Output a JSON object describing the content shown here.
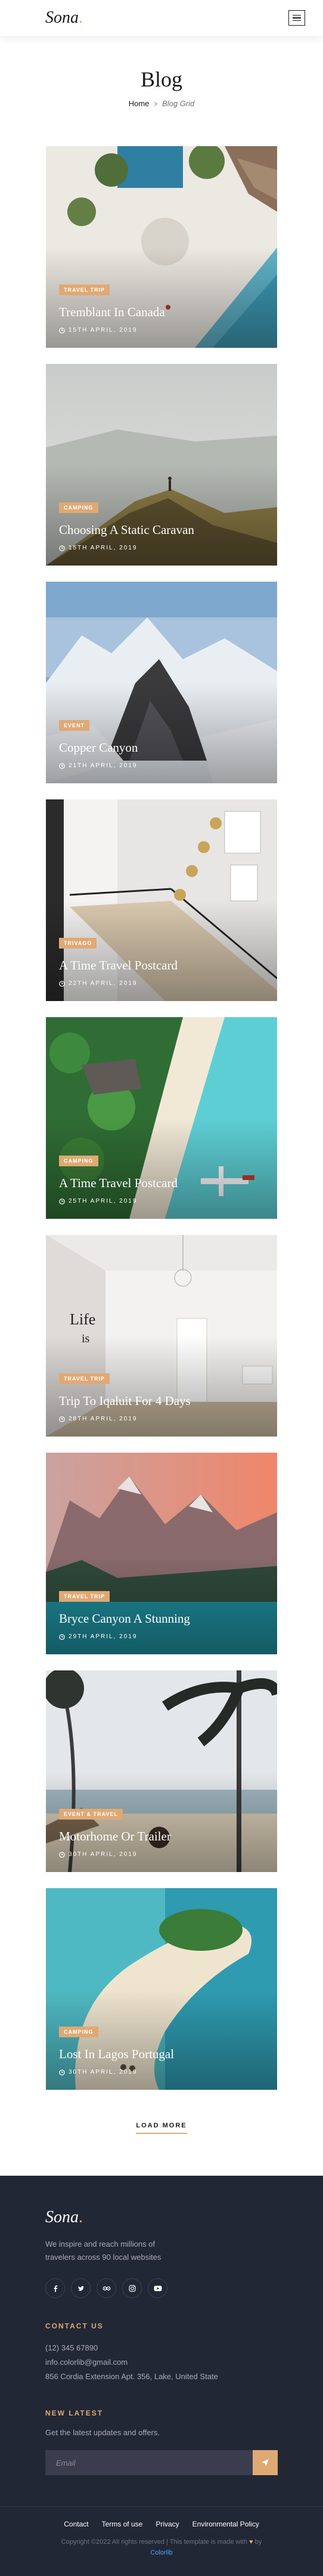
{
  "header": {
    "logo": "Sona",
    "logo_dot": "."
  },
  "breadcrumb": {
    "title": "Blog",
    "home": "Home",
    "separator": ">",
    "current": "Blog Grid"
  },
  "posts": [
    {
      "tag": "Travel Trip",
      "title": "Tremblant In Canada",
      "date": "15th April, 2019"
    },
    {
      "tag": "Camping",
      "title": "Choosing A Static Caravan",
      "date": "15th April, 2019"
    },
    {
      "tag": "Event",
      "title": "Copper Canyon",
      "date": "21th April, 2019"
    },
    {
      "tag": "Trivago",
      "title": "A Time Travel Postcard",
      "date": "22th April, 2019"
    },
    {
      "tag": "Camping",
      "title": "A Time Travel Postcard",
      "date": "25th April, 2019"
    },
    {
      "tag": "Travel Trip",
      "title": "Trip To Iqaluit For 4 Days",
      "date": "28th April, 2019"
    },
    {
      "tag": "Travel Trip",
      "title": "Bryce Canyon A Stunning",
      "date": "29th April, 2019"
    },
    {
      "tag": "Event & Travel",
      "title": "Motorhome Or Trailer",
      "date": "30th April, 2019"
    },
    {
      "tag": "Camping",
      "title": "Lost In Lagos Portugal",
      "date": "30th April, 2019"
    }
  ],
  "load_more": "Load More",
  "footer": {
    "logo": "Sona",
    "logo_dot": ".",
    "about": "We inspire and reach millions of travelers across 90 local websites",
    "socials": [
      "facebook-icon",
      "twitter-icon",
      "tripadvisor-icon",
      "instagram-icon",
      "youtube-icon"
    ],
    "contact_heading": "Contact Us",
    "phone": "(12) 345 67890",
    "email": "info.colorlib@gmail.com",
    "address": "856 Cordia Extension Apt. 356, Lake, United State",
    "newsletter_heading": "New Latest",
    "newsletter_text": "Get the latest updates and offers.",
    "email_placeholder": "Email",
    "links": [
      "Contact",
      "Terms of use",
      "Privacy",
      "Environmental Policy"
    ],
    "copyright": "Copyright ©2022 All rights reserved | This template is made with",
    "copyright_by": "by",
    "brand": "Colorlib"
  },
  "colors": {
    "accent": "#dfa974",
    "footer_bg": "#222736",
    "text": "#19191a"
  }
}
